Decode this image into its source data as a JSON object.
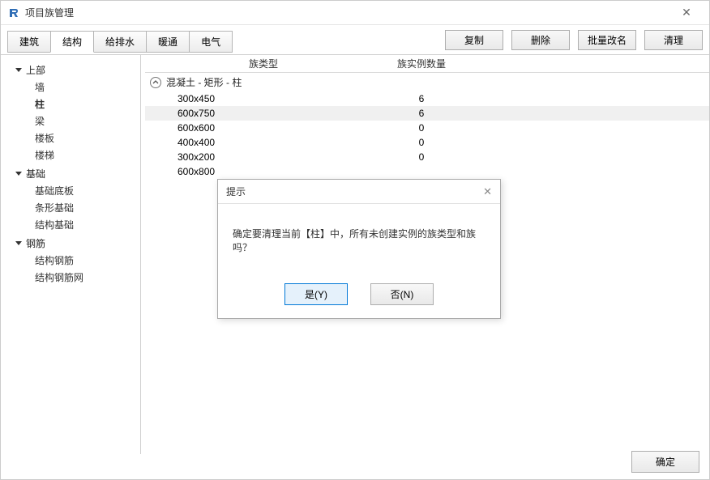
{
  "window": {
    "title": "项目族管理",
    "close_glyph": "✕"
  },
  "tabs": [
    {
      "label": "建筑"
    },
    {
      "label": "结构"
    },
    {
      "label": "给排水"
    },
    {
      "label": "暖通"
    },
    {
      "label": "电气"
    }
  ],
  "active_tab_index": 1,
  "toolbar_buttons": {
    "copy": "复制",
    "delete": "删除",
    "batch_rename": "批量改名",
    "clean": "清理"
  },
  "tree": [
    {
      "title": "上部",
      "children": [
        "墙",
        "柱",
        "梁",
        "楼板",
        "楼梯"
      ],
      "selected_index": 1
    },
    {
      "title": "基础",
      "children": [
        "基础底板",
        "条形基础",
        "结构基础"
      ]
    },
    {
      "title": "钢筋",
      "children": [
        "结构钢筋",
        "结构钢筋网"
      ]
    }
  ],
  "table": {
    "headers": {
      "type": "族类型",
      "count": "族实例数量"
    },
    "group": "混凝土 - 矩形 - 柱",
    "rows": [
      {
        "type": "300x450",
        "count": "6"
      },
      {
        "type": "600x750",
        "count": "6"
      },
      {
        "type": "600x600",
        "count": "0"
      },
      {
        "type": "400x400",
        "count": "0"
      },
      {
        "type": "300x200",
        "count": "0"
      },
      {
        "type": "600x800",
        "count": ""
      }
    ],
    "selected_row_index": 1
  },
  "footer": {
    "ok": "确定"
  },
  "dialog": {
    "title": "提示",
    "close_glyph": "✕",
    "message": "确定要清理当前【柱】中，所有未创建实例的族类型和族吗？",
    "yes": "是(Y)",
    "no": "否(N)"
  }
}
